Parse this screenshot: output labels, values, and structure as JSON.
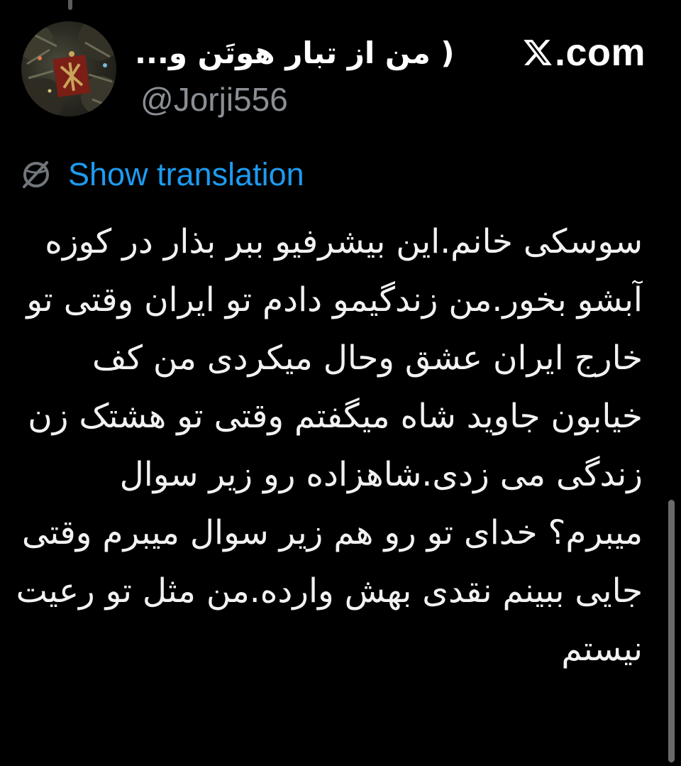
{
  "header": {
    "display_name": "( من از تبار هوتَن و...",
    "handle": "@Jorji556",
    "brand_label": ".com",
    "brand_icon": "x-logo-icon"
  },
  "avatar": {
    "icon": "avatar-image"
  },
  "translation": {
    "icon": "globe-slash-icon",
    "label": "Show translation"
  },
  "tweet": {
    "text": "سوسکی خانم.این بیشرفیو ببر بذار در کوزه آبشو بخور.من زندگیمو دادم تو ایران وقتی تو خارج  ایران عشق وحال میکردی من کف خیابون جاوید شاه میگفتم وقتی تو هشتک زن زندگی می زدی.شاهزاده رو زیر سوال میبرم؟ خدای تو رو هم زیر سوال میبرم وقتی جایی ببینم نقدی بهش وارده.من مثل تو  رعیت نیستم"
  },
  "colors": {
    "background": "#000000",
    "text": "#f2f2f2",
    "link": "#1d9bf0",
    "muted": "#8b8f94"
  }
}
